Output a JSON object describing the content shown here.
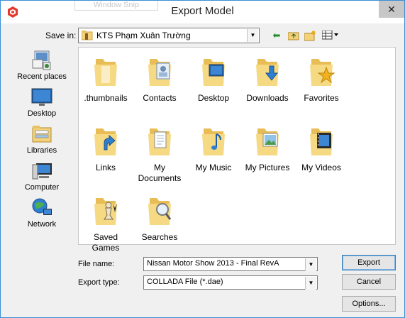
{
  "window": {
    "title": "Export Model",
    "behind_tab": "Window Snip",
    "close_glyph": "✕"
  },
  "location": {
    "save_in_label": "Save in:",
    "current_folder": "KTS Phạm Xuân Trường",
    "nav_icons": [
      "back-arrow-icon",
      "up-folder-icon",
      "new-folder-icon",
      "view-menu-icon"
    ]
  },
  "places": [
    {
      "label": "Recent places",
      "icon": "recent-places-icon"
    },
    {
      "label": "Desktop",
      "icon": "desktop-icon"
    },
    {
      "label": "Libraries",
      "icon": "libraries-icon"
    },
    {
      "label": "Computer",
      "icon": "computer-icon"
    },
    {
      "label": "Network",
      "icon": "network-icon"
    }
  ],
  "files": [
    {
      "label": ".thumbnails",
      "icon": "folder-icon"
    },
    {
      "label": "Contacts",
      "icon": "contacts-folder-icon"
    },
    {
      "label": "Desktop",
      "icon": "desktop-folder-icon"
    },
    {
      "label": "Downloads",
      "icon": "downloads-folder-icon"
    },
    {
      "label": "Favorites",
      "icon": "favorites-folder-icon"
    },
    {
      "label": "Links",
      "icon": "links-folder-icon"
    },
    {
      "label": "My Documents",
      "icon": "documents-folder-icon"
    },
    {
      "label": "My Music",
      "icon": "music-folder-icon"
    },
    {
      "label": "My Pictures",
      "icon": "pictures-folder-icon"
    },
    {
      "label": "My Videos",
      "icon": "videos-folder-icon"
    },
    {
      "label": "Saved Games",
      "icon": "saved-games-folder-icon"
    },
    {
      "label": "Searches",
      "icon": "searches-folder-icon"
    }
  ],
  "form": {
    "file_name_label": "File name:",
    "file_name_value": "Nissan Motor Show 2013 - Final RevA",
    "export_type_label": "Export type:",
    "export_type_value": "COLLADA File (*.dae)"
  },
  "buttons": {
    "export": "Export",
    "cancel": "Cancel",
    "options": "Options..."
  },
  "colors": {
    "folder": "#f3d27a",
    "window_border": "#3a8fd6",
    "close_button": "#c7c7c7"
  }
}
